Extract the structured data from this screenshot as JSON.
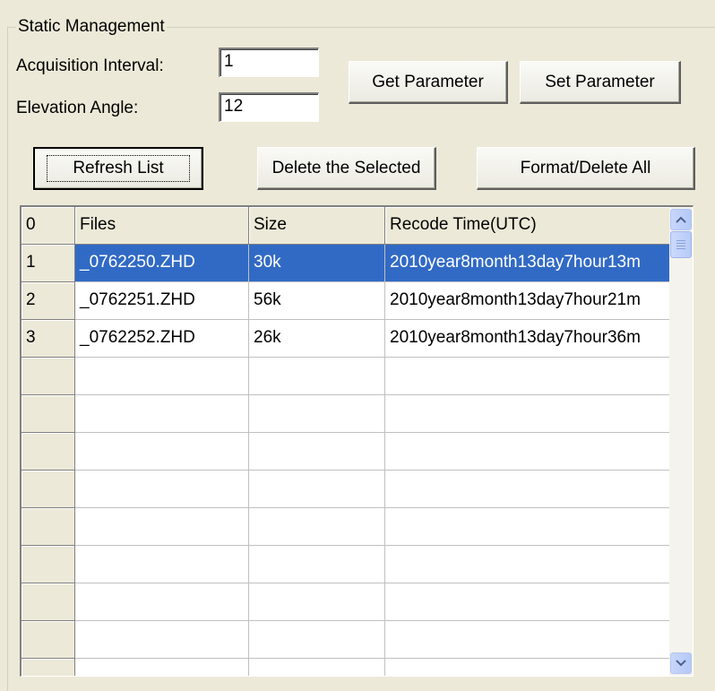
{
  "group": {
    "title": "Static Management"
  },
  "params": {
    "interval_label": "Acquisition Interval:",
    "interval_value": "1",
    "elevation_label": "Elevation Angle:",
    "elevation_value": "12"
  },
  "buttons": {
    "get_parameter": "Get Parameter",
    "set_parameter": "Set Parameter",
    "refresh_list": "Refresh List",
    "delete_selected": "Delete the Selected",
    "format_delete_all": "Format/Delete All"
  },
  "table": {
    "columns": [
      "0",
      "Files",
      "Size",
      "Recode Time(UTC)"
    ],
    "rows": [
      {
        "index": "1",
        "file": "_0762250.ZHD",
        "size": "30k",
        "time": "2010year8month13day7hour13m",
        "selected": true
      },
      {
        "index": "2",
        "file": "_0762251.ZHD",
        "size": "56k",
        "time": "2010year8month13day7hour21m",
        "selected": false
      },
      {
        "index": "3",
        "file": "_0762252.ZHD",
        "size": "26k",
        "time": "2010year8month13day7hour36m",
        "selected": false
      }
    ],
    "empty_rows": 9
  },
  "colors": {
    "selection": "#316ac5",
    "window_bg": "#ece9d8"
  },
  "icons": {
    "scroll_up": "chevron-up-icon",
    "scroll_down": "chevron-down-icon"
  }
}
